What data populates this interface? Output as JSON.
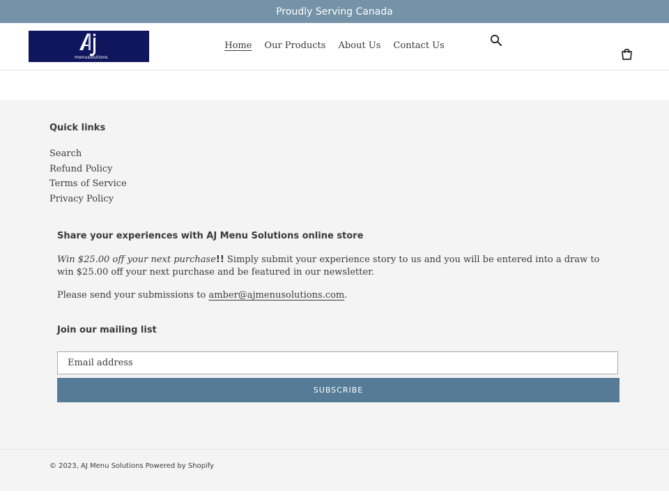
{
  "announcement": {
    "text": "Proudly Serving Canada"
  },
  "header": {
    "logo_text": "menusolutions",
    "nav": [
      {
        "label": "Home",
        "active": true
      },
      {
        "label": "Our Products"
      },
      {
        "label": "About Us"
      },
      {
        "label": "Contact Us"
      }
    ],
    "icons": {
      "search": "search-icon",
      "cart": "cart-icon"
    }
  },
  "footer": {
    "quick_links_title": "Quick links",
    "quick_links": [
      "Search",
      "Refund Policy",
      "Terms of Service",
      "Privacy Policy"
    ],
    "share_title": "Share your experiences with AJ Menu Solutions online store",
    "share_italic": "Win $25.00 off your next purchase",
    "share_bold": "!!",
    "share_text": "  Simply submit your experience story to us and you will be entered into a draw to win $25.00 off your next purchase and be featured in our newsletter.",
    "send_prefix": "Please send your submissions to ",
    "send_email": "amber@ajmenusolutions.com",
    "send_suffix": ".",
    "mailing_title": "Join our mailing list",
    "email_placeholder": "Email address",
    "subscribe_label": "SUBSCRIBE",
    "copyright": "© 2023, AJ Menu Solutions",
    "powered_by": "Powered by Shopify"
  },
  "colors": {
    "announcement_bg": "#7492a8",
    "logo_bg": "#10165e",
    "footer_bg": "#f4f4f4",
    "button_bg": "#557b97"
  }
}
